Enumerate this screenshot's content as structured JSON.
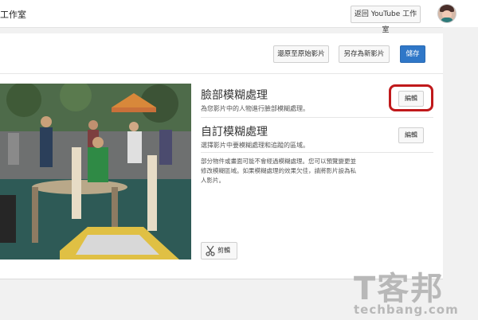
{
  "topbar": {
    "title_fragment": "工作室",
    "studio_button": "返回 YouTube 工作室"
  },
  "actions": {
    "revert": "還原至原始影片",
    "save_as_new": "另存為新影片",
    "save": "儲存"
  },
  "face_blur": {
    "title": "臉部模糊處理",
    "description": "為您影片中的人物進行臉部模糊處理。",
    "edit": "編輯"
  },
  "custom_blur": {
    "title": "自訂模糊處理",
    "description": "選擇影片中要模糊處理和追蹤的區域。",
    "edit": "編輯"
  },
  "note": "部分物件或畫面可能不會經過模糊處理。您可以預覽變更並修改模糊區域。如果模糊處理的效果欠佳，請將影片設為私人影片。",
  "trim": {
    "label": "剪輯",
    "icon": "scissors-icon"
  },
  "watermark": {
    "logo": "T客邦",
    "text": "techbang.com"
  },
  "colors": {
    "primary_button": "#2f77c8",
    "highlight": "#c0191b"
  }
}
